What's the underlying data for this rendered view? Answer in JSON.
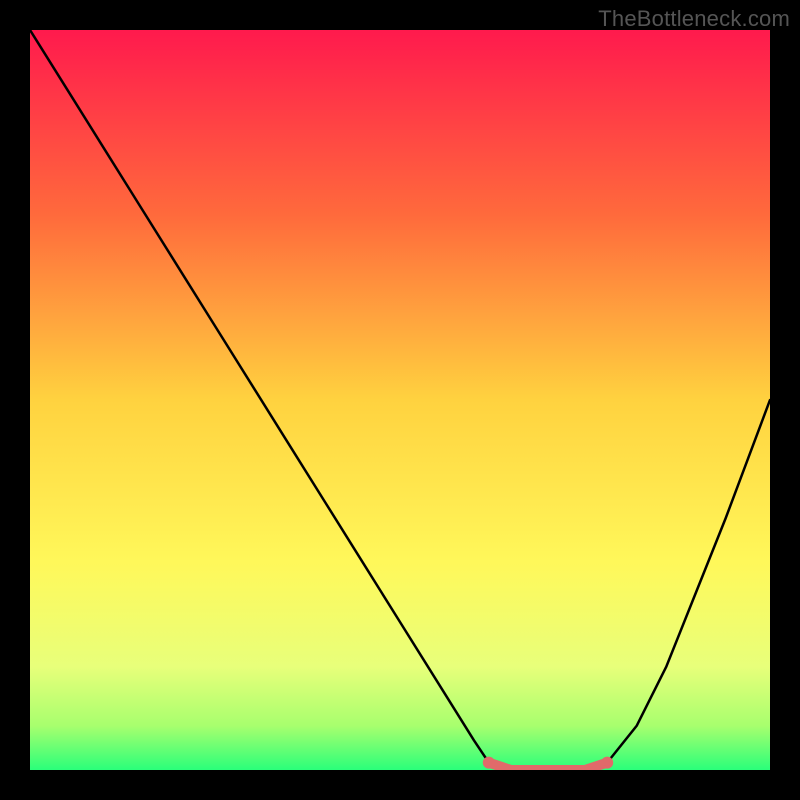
{
  "watermark": "TheBottleneck.com",
  "chart_data": {
    "type": "line",
    "title": "",
    "xlabel": "",
    "ylabel": "",
    "xlim": [
      0,
      100
    ],
    "ylim": [
      0,
      100
    ],
    "annotations": [],
    "gradient_stops": [
      {
        "offset": 0,
        "color": "#ff1a4d"
      },
      {
        "offset": 25,
        "color": "#ff6a3c"
      },
      {
        "offset": 50,
        "color": "#ffd23f"
      },
      {
        "offset": 72,
        "color": "#fff85a"
      },
      {
        "offset": 86,
        "color": "#e8ff7a"
      },
      {
        "offset": 94,
        "color": "#a8ff6e"
      },
      {
        "offset": 100,
        "color": "#2aff7a"
      }
    ],
    "series": [
      {
        "name": "bottleneck-curve",
        "x": [
          0,
          5,
          10,
          15,
          20,
          25,
          30,
          35,
          40,
          45,
          50,
          55,
          60,
          62,
          65,
          70,
          75,
          78,
          82,
          86,
          90,
          94,
          100
        ],
        "values": [
          100,
          92,
          84,
          76,
          68,
          60,
          52,
          44,
          36,
          28,
          20,
          12,
          4,
          1,
          0,
          0,
          0,
          1,
          6,
          14,
          24,
          34,
          50
        ]
      },
      {
        "name": "highlight-segment",
        "x": [
          62,
          65,
          70,
          75,
          78
        ],
        "values": [
          1,
          0,
          0,
          0,
          1
        ]
      }
    ],
    "highlight_color": "#e16a6a"
  }
}
